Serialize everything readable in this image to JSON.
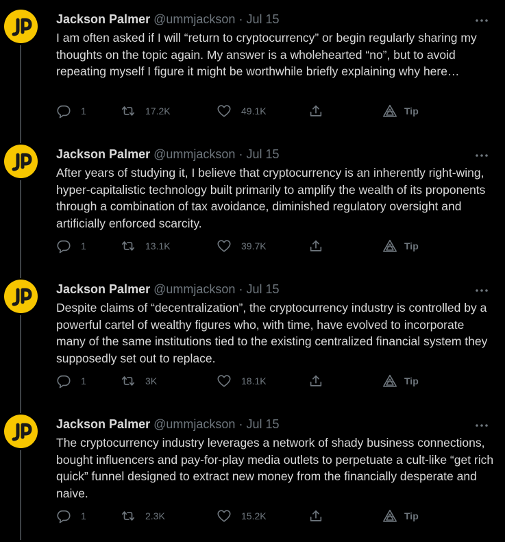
{
  "author": {
    "name": "Jackson Palmer",
    "handle": "@ummjackson",
    "separator": "·",
    "date": "Jul 15",
    "avatar_color": "#f7c600",
    "avatar_letter_color": "#1a1a1a"
  },
  "colors": {
    "background": "#000000",
    "text": "#d9d9d9",
    "muted": "#6e767d",
    "thread_line": "#3d4145"
  },
  "icons": {
    "more": "more-horizontal-icon",
    "reply": "reply-bubble-icon",
    "retweet": "retweet-icon",
    "like": "heart-icon",
    "share": "share-icon",
    "tip": "tip-icon"
  },
  "tip_label": "Tip",
  "tweets": [
    {
      "text": "I am often asked if I will “return to cryptocurrency” or begin regularly sharing my thoughts on the topic again. My answer is a wholehearted “no”, but to avoid repeating myself I figure it might be worthwhile briefly explaining why here…",
      "replies": "1",
      "retweets": "17.2K",
      "likes": "49.1K"
    },
    {
      "text": "After years of studying it, I believe that cryptocurrency is an inherently right-wing, hyper-capitalistic technology built primarily to amplify the wealth of its proponents through a combination of tax avoidance, diminished regulatory oversight and artificially enforced scarcity.",
      "replies": "1",
      "retweets": "13.1K",
      "likes": "39.7K"
    },
    {
      "text": "Despite claims of “decentralization”, the cryptocurrency industry is controlled by a powerful cartel of wealthy figures who, with time, have evolved to incorporate many of the same institutions tied to the existing centralized financial system they supposedly set out to replace.",
      "replies": "1",
      "retweets": "3K",
      "likes": "18.1K"
    },
    {
      "text": "The cryptocurrency industry leverages a network of shady business connections, bought influencers and pay-for-play media outlets to perpetuate a cult-like “get rich quick” funnel designed to extract new money from the financially desperate and naive.",
      "replies": "1",
      "retweets": "2.3K",
      "likes": "15.2K"
    }
  ]
}
